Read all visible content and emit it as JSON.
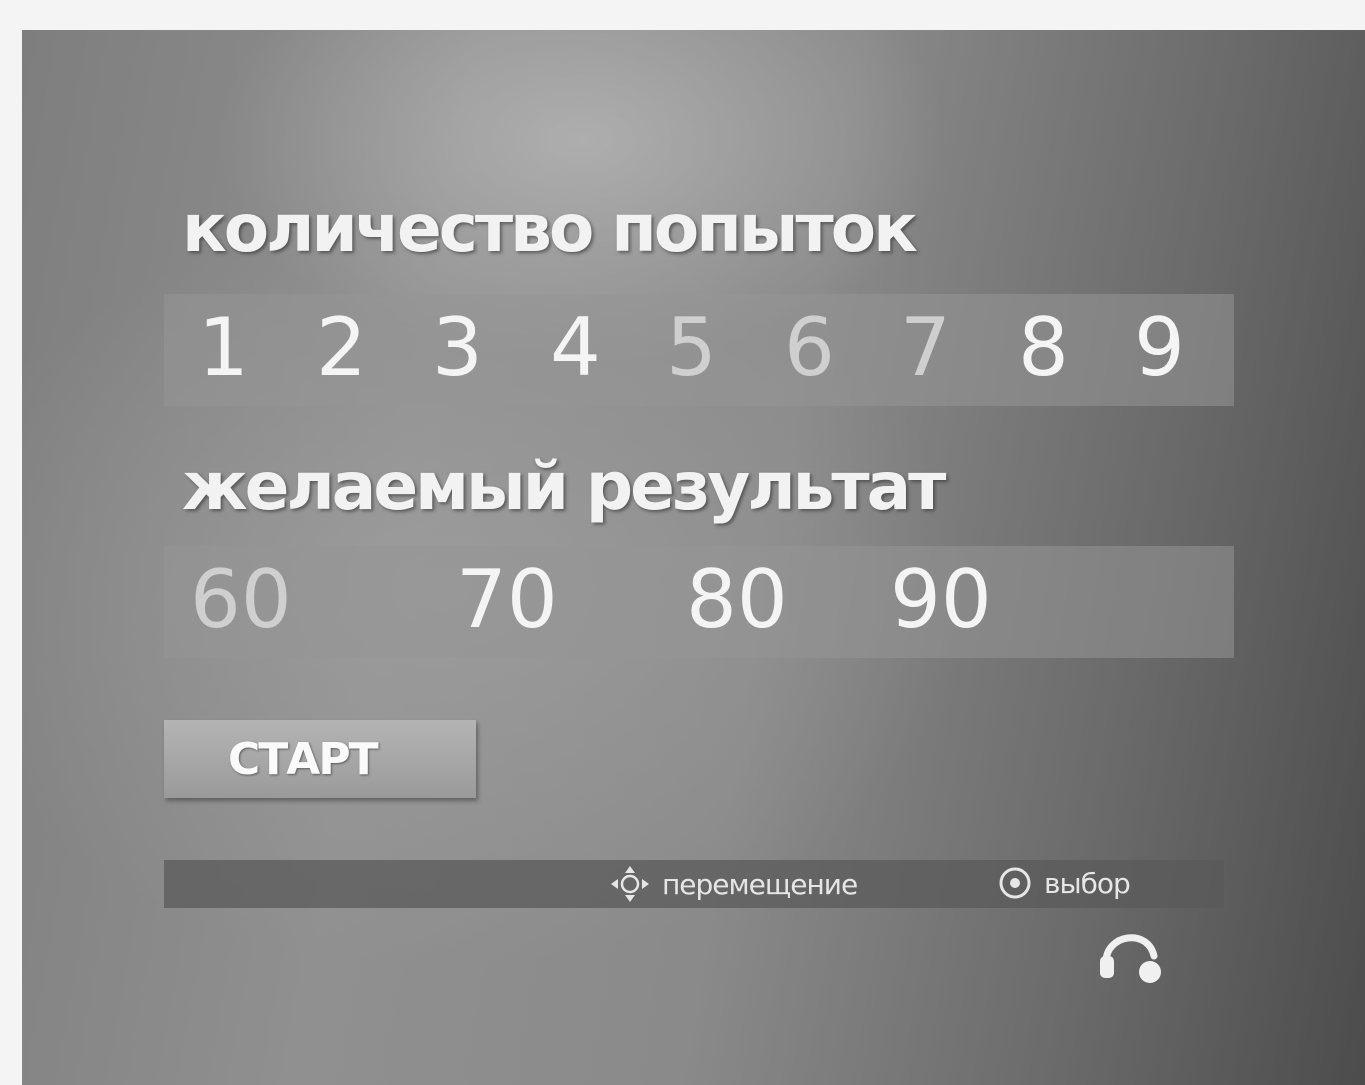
{
  "screen": {
    "attempts": {
      "title": "количество попыток",
      "options": [
        "1",
        "2",
        "3",
        "4",
        "5",
        "6",
        "7",
        "8",
        "9"
      ]
    },
    "result": {
      "title": "желаемый результат",
      "options": [
        "60",
        "70",
        "80",
        "90"
      ]
    },
    "start_label": "СТАРТ",
    "hints": {
      "move": "перемещение",
      "select": "выбор"
    },
    "icons": {
      "move": "dpad-arrows-icon",
      "select": "select-circle-icon",
      "headset": "headset-icon"
    }
  }
}
